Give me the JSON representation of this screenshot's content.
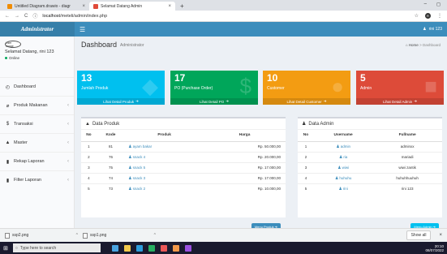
{
  "browser": {
    "tabs": [
      {
        "title": "Untitled Diagram.drawio - diagr"
      },
      {
        "title": "Selamat Datang Admin"
      }
    ],
    "new_tab": "+",
    "window_controls": [
      "–",
      "◻"
    ],
    "url_host": "localhost",
    "url_path": "/meteli/admin/index.php",
    "profile_letter": "R"
  },
  "header": {
    "logo": "Administrator",
    "menu_icon": "☰",
    "user": "rini 123"
  },
  "sidebar": {
    "avatar_alt": "User Image",
    "user_name": "Selamat Datang, rini 123",
    "status": "Online",
    "items": [
      {
        "label": "Dashboard",
        "icon": "dashboard-icon",
        "glyph": "◴",
        "chevron": ""
      },
      {
        "label": "Produk Makanan",
        "icon": "tag-icon",
        "glyph": "⌀",
        "chevron": "‹"
      },
      {
        "label": "Transaksi",
        "icon": "dollar-icon",
        "glyph": "$",
        "chevron": "‹"
      },
      {
        "label": "Master",
        "icon": "master-icon",
        "glyph": "▲",
        "chevron": "‹"
      },
      {
        "label": "Rekap Laporan",
        "icon": "book-icon",
        "glyph": "▮",
        "chevron": "‹"
      },
      {
        "label": "Filter Laporan",
        "icon": "book-icon",
        "glyph": "▮",
        "chevron": "‹"
      }
    ]
  },
  "page": {
    "title": "Dashboard",
    "subtitle": "Administrator",
    "breadcrumb_home": "Home",
    "breadcrumb_sep": ">",
    "breadcrumb_current": "Dashboard"
  },
  "stat_boxes": [
    {
      "number": "13",
      "label": "Jumlah Produk",
      "link": "Lihat Detail Produk",
      "color": "#00c0ef"
    },
    {
      "number": "17",
      "label": "PO (Purchase Order)",
      "link": "Lihat Detail PO",
      "color": "#00a65a"
    },
    {
      "number": "10",
      "label": "Customer",
      "link": "Lihat Detail Customer",
      "color": "#f39c12"
    },
    {
      "number": "5",
      "label": "Admin",
      "link": "Lihat Detail Admin",
      "color": "#dd4b39"
    }
  ],
  "produk": {
    "title": "Data Produk",
    "headers": [
      "No",
      "Kode",
      "Produk",
      "Harga"
    ],
    "rows": [
      [
        "1",
        "81",
        "ayam bakar",
        "Rp. 50.000,00"
      ],
      [
        "2",
        "76",
        "snack 4",
        "Rp. 20.000,00"
      ],
      [
        "3",
        "75",
        "snack 5",
        "Rp. 17.000,00"
      ],
      [
        "4",
        "74",
        "snack 3",
        "Rp. 17.000,00"
      ],
      [
        "5",
        "73",
        "snack 2",
        "Rp. 10.000,00"
      ]
    ],
    "button": "Menu Produk"
  },
  "admin": {
    "title": "Data Admin",
    "headers": [
      "No",
      "Username",
      "Fullname"
    ],
    "rows": [
      [
        "1",
        "admin",
        "adminxx"
      ],
      [
        "2",
        "ria",
        "mariadi"
      ],
      [
        "3",
        "wiwi",
        "wiwi zantik"
      ],
      [
        "4",
        "huhuhu",
        "huhuhhuuhuh"
      ],
      [
        "5",
        "rini",
        "rini 123"
      ]
    ],
    "button": "Menu Admin"
  },
  "downloads": {
    "items": [
      "ssp2.png",
      "ssp1.png"
    ],
    "show_all": "Show all"
  },
  "taskbar": {
    "search_placeholder": "Type here to search",
    "time": "20:10",
    "date": "08/07/2022"
  }
}
